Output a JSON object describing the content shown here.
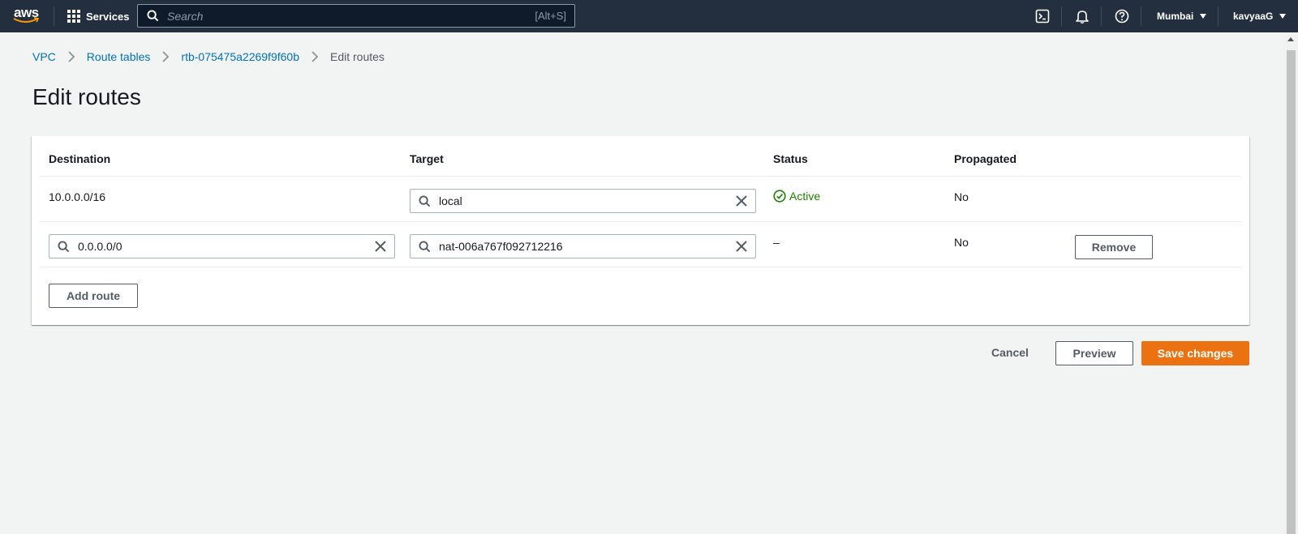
{
  "topnav": {
    "logo": "aws",
    "services_label": "Services",
    "search_placeholder": "Search",
    "search_shortcut": "[Alt+S]",
    "region": "Mumbai",
    "user": "kavyaaG",
    "icons": [
      "cloudshell-icon",
      "bell-icon",
      "help-icon"
    ]
  },
  "breadcrumb": {
    "items": [
      "VPC",
      "Route tables",
      "rtb-075475a2269f9f60b"
    ],
    "current": "Edit routes"
  },
  "page": {
    "title": "Edit routes"
  },
  "table": {
    "headers": {
      "destination": "Destination",
      "target": "Target",
      "status": "Status",
      "propagated": "Propagated"
    },
    "rows": [
      {
        "destination": "10.0.0.0/16",
        "target": "local",
        "status": "Active",
        "propagated": "No"
      },
      {
        "destination": "0.0.0.0/0",
        "target": "nat-006a767f092712216",
        "status": "–",
        "propagated": "No",
        "remove_label": "Remove"
      }
    ],
    "add_route_label": "Add route"
  },
  "actions": {
    "cancel": "Cancel",
    "preview": "Preview",
    "save": "Save changes"
  },
  "colors": {
    "nav_bg": "#232f3e",
    "link": "#0073bb",
    "primary": "#ec7211",
    "success": "#1d8102",
    "page_bg": "#f2f3f3"
  }
}
